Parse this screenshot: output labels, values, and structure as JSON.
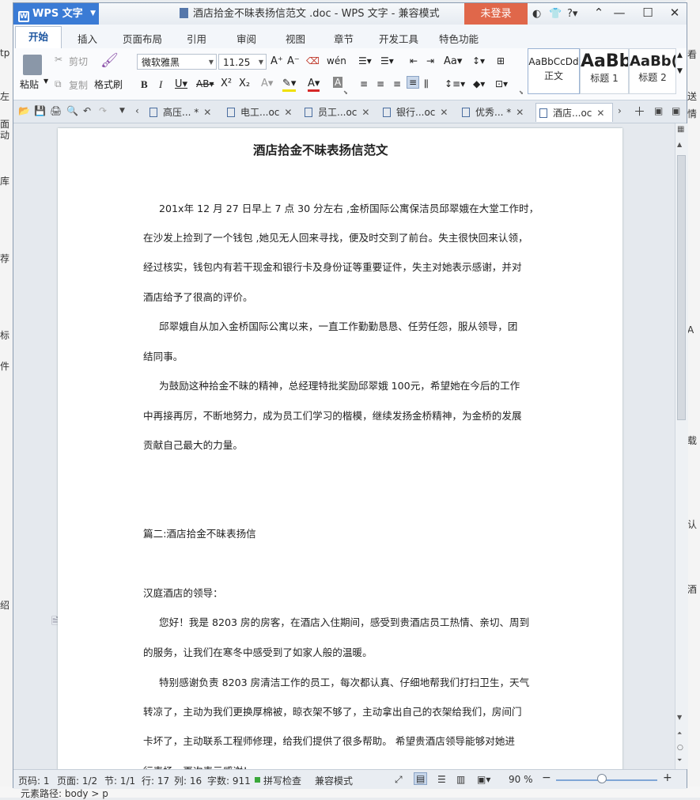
{
  "background": {
    "left_fragments": [
      "tp",
      "左",
      "面",
      "动",
      "库",
      "荐",
      "标",
      "件",
      "绍"
    ],
    "right_fragments": [
      "送",
      "情",
      "看",
      "A",
      "载",
      "认",
      "酒"
    ],
    "bottom_text": "元素路径: body > p"
  },
  "titlebar": {
    "app_name": "WPS 文字",
    "doc_title": "酒店拾金不昧表扬信范文 .doc - WPS 文字 - 兼容模式",
    "login_label": "未登录"
  },
  "menu": {
    "tabs": [
      "开始",
      "插入",
      "页面布局",
      "引用",
      "审阅",
      "视图",
      "章节",
      "开发工具",
      "特色功能"
    ]
  },
  "ribbon": {
    "paste": "粘贴",
    "cut": "剪切",
    "copy": "复制",
    "format_painter": "格式刷",
    "font_name": "微软雅黑",
    "font_size": "11.25",
    "styles": [
      {
        "sample": "AaBbCcDd",
        "name": "正文"
      },
      {
        "sample": "AaBb",
        "name": "标题 1"
      },
      {
        "sample": "AaBb(",
        "name": "标题 2"
      }
    ]
  },
  "doc_tabs": [
    {
      "label": "高压... *"
    },
    {
      "label": "电工...oc"
    },
    {
      "label": "员工...oc"
    },
    {
      "label": "银行...oc"
    },
    {
      "label": "优秀... *"
    },
    {
      "label": "酒店...oc"
    }
  ],
  "document": {
    "title": "酒店拾金不昧表扬信范文",
    "lines": [
      "201x年 12 月 27 日早上 7 点 30 分左右 ,金桥国际公寓保洁员邱翠娥在大堂工作时，",
      "在沙发上捡到了一个钱包 ,她见无人回来寻找，便及时交到了前台。失主很快回来认领，",
      "经过核实，钱包内有若干现金和银行卡及身份证等重要证件，失主对她表示感谢，并对",
      "酒店给予了很高的评价。",
      "邱翠娥自从加入金桥国际公寓以来，一直工作勤勤恳恳、任劳任怨，服从领导，团",
      "结同事。",
      "为鼓励这种拾金不昧的精神，总经理特批奖励邱翠娥 100元，希望她在今后的工作",
      "中再接再厉，不断地努力，成为员工们学习的楷模，继续发扬金桥精神，为金桥的发展",
      "贡献自己最大的力量。",
      "篇二:酒店拾金不昧表扬信",
      "汉庭酒店的领导：",
      "您好！我是 8203 房的房客，在酒店入住期间，感受到贵酒店员工热情、亲切、周到",
      "的服务，让我们在寒冬中感受到了如家人般的温暖。",
      "特别感谢负责 8203 房清洁工作的员工，每次都认真、仔细地帮我们打扫卫生，天气",
      "转凉了，主动为我们更换厚棉被，晾衣架不够了，主动拿出自己的衣架给我们，房间门",
      "卡坏了，主动联系工程师修理，给我们提供了很多帮助。 希望贵酒店领导能够对她进",
      "行表扬，再次表示感谢！"
    ]
  },
  "status": {
    "page_code": "页码: 1",
    "pages": "页面: 1/2",
    "section": "节: 1/1",
    "row": "行: 17",
    "column": "列: 16",
    "word_count": "字数: 911",
    "spellcheck": "拼写检查",
    "mode": "兼容模式",
    "zoom": "90 %",
    "zoom_level": 0.45
  },
  "colors": {
    "accent": "#3a7bd5",
    "login": "#e0674a"
  }
}
